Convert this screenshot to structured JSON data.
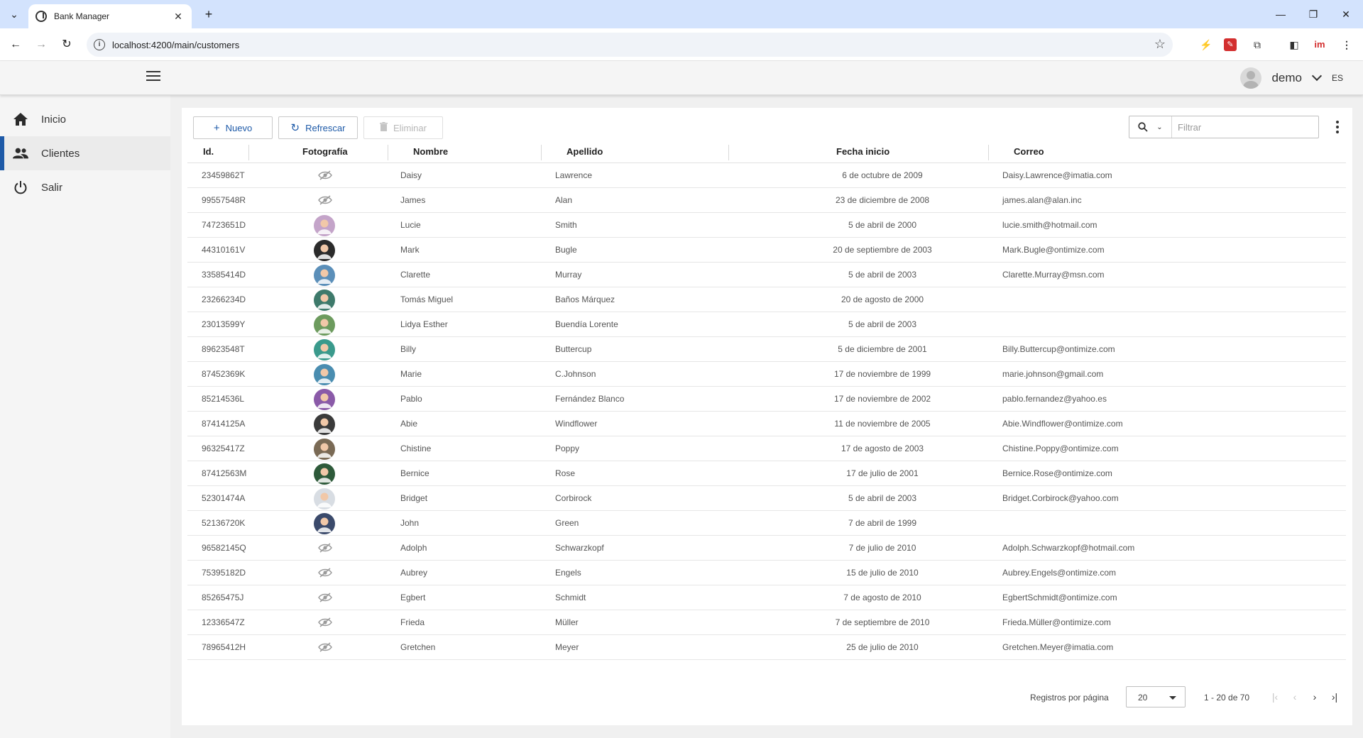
{
  "browser": {
    "tab_title": "Bank Manager",
    "url": "localhost:4200/main/customers"
  },
  "header": {
    "user_name": "demo",
    "language": "ES"
  },
  "sidebar": {
    "items": [
      {
        "label": "Inicio",
        "icon": "home-icon"
      },
      {
        "label": "Clientes",
        "icon": "people-icon",
        "active": true
      },
      {
        "label": "Salir",
        "icon": "power-icon"
      }
    ]
  },
  "toolbar": {
    "new_label": "Nuevo",
    "refresh_label": "Refrescar",
    "delete_label": "Eliminar",
    "filter_placeholder": "Filtrar"
  },
  "table": {
    "columns": [
      "Id.",
      "Fotografía",
      "Nombre",
      "Apellido",
      "Fecha inicio",
      "Correo"
    ],
    "rows": [
      {
        "id": "23459862T",
        "photo": "none",
        "name": "Daisy",
        "surname": "Lawrence",
        "start": "6 de octubre de 2009",
        "email": "Daisy.Lawrence@imatia.com"
      },
      {
        "id": "99557548R",
        "photo": "none",
        "name": "James",
        "surname": "Alan",
        "start": "23 de diciembre de 2008",
        "email": "james.alan@alan.inc"
      },
      {
        "id": "74723651D",
        "photo": "#c4a4c9",
        "name": "Lucie",
        "surname": "Smith",
        "start": "5 de abril de 2000",
        "email": "lucie.smith@hotmail.com"
      },
      {
        "id": "44310161V",
        "photo": "#2b2b2b",
        "name": "Mark",
        "surname": "Bugle",
        "start": "20 de septiembre de 2003",
        "email": "Mark.Bugle@ontimize.com"
      },
      {
        "id": "33585414D",
        "photo": "#5b8fb9",
        "name": "Clarette",
        "surname": "Murray",
        "start": "5 de abril de 2003",
        "email": "Clarette.Murray@msn.com"
      },
      {
        "id": "23266234D",
        "photo": "#3e7a6b",
        "name": "Tomás Miguel",
        "surname": "Baños Márquez",
        "start": "20 de agosto de 2000",
        "email": ""
      },
      {
        "id": "23013599Y",
        "photo": "#6d9b5e",
        "name": "Lidya Esther",
        "surname": "Buendía Lorente",
        "start": "5 de abril de 2003",
        "email": ""
      },
      {
        "id": "89623548T",
        "photo": "#3a9a8c",
        "name": "Billy",
        "surname": "Buttercup",
        "start": "5 de diciembre de 2001",
        "email": "Billy.Buttercup@ontimize.com"
      },
      {
        "id": "87452369K",
        "photo": "#4a8db0",
        "name": "Marie",
        "surname": "C.Johnson",
        "start": "17 de noviembre de 1999",
        "email": "marie.johnson@gmail.com"
      },
      {
        "id": "85214536L",
        "photo": "#8a5aa8",
        "name": "Pablo",
        "surname": "Fernández Blanco",
        "start": "17 de noviembre de 2002",
        "email": "pablo.fernandez@yahoo.es"
      },
      {
        "id": "87414125A",
        "photo": "#3b3b3b",
        "name": "Abie",
        "surname": "Windflower",
        "start": "11 de noviembre de 2005",
        "email": "Abie.Windflower@ontimize.com"
      },
      {
        "id": "96325417Z",
        "photo": "#7a6a55",
        "name": "Chistine",
        "surname": "Poppy",
        "start": "17 de agosto de 2003",
        "email": "Chistine.Poppy@ontimize.com"
      },
      {
        "id": "87412563M",
        "photo": "#2e5a3a",
        "name": "Bernice",
        "surname": "Rose",
        "start": "17 de julio de 2001",
        "email": "Bernice.Rose@ontimize.com"
      },
      {
        "id": "52301474A",
        "photo": "#d8dde3",
        "name": "Bridget",
        "surname": "Corbirock",
        "start": "5 de abril de 2003",
        "email": "Bridget.Corbirock@yahoo.com"
      },
      {
        "id": "52136720K",
        "photo": "#3b4a6b",
        "name": "John",
        "surname": "Green",
        "start": "7 de abril de 1999",
        "email": ""
      },
      {
        "id": "96582145Q",
        "photo": "none",
        "name": "Adolph",
        "surname": "Schwarzkopf",
        "start": "7 de julio de 2010",
        "email": "Adolph.Schwarzkopf@hotmail.com"
      },
      {
        "id": "75395182D",
        "photo": "none",
        "name": "Aubrey",
        "surname": "Engels",
        "start": "15 de julio de 2010",
        "email": "Aubrey.Engels@ontimize.com"
      },
      {
        "id": "85265475J",
        "photo": "none",
        "name": "Egbert",
        "surname": "Schmidt",
        "start": "7 de agosto de 2010",
        "email": "EgbertSchmidt@ontimize.com"
      },
      {
        "id": "12336547Z",
        "photo": "none",
        "name": "Frieda",
        "surname": "Müller",
        "start": "7 de septiembre de 2010",
        "email": "Frieda.Müller@ontimize.com"
      },
      {
        "id": "78965412H",
        "photo": "none",
        "name": "Gretchen",
        "surname": "Meyer",
        "start": "25 de julio de 2010",
        "email": "Gretchen.Meyer@imatia.com"
      }
    ]
  },
  "paginator": {
    "label": "Registros por página",
    "page_size": "20",
    "range": "1 - 20 de 70"
  },
  "colors": {
    "accent": "#1e5aa8",
    "chrome_tabstrip": "#d3e3fd",
    "app_bg": "#f0f0f0"
  }
}
